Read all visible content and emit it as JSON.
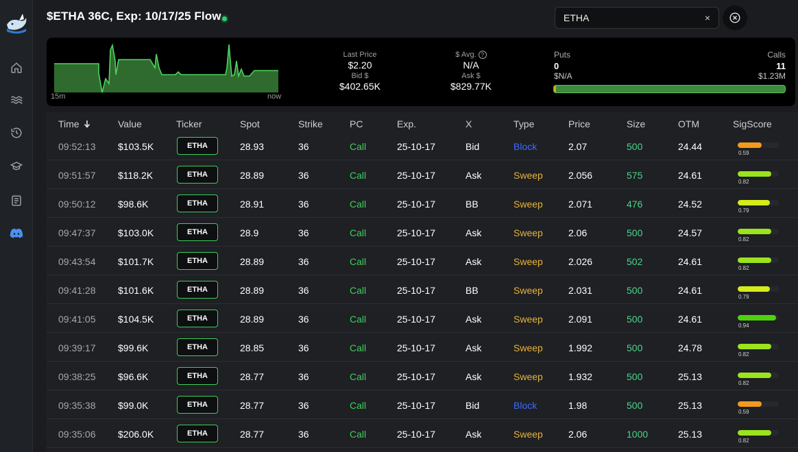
{
  "header": {
    "title": "$ETHA 36C, Exp: 10/17/25 Flow"
  },
  "search": {
    "value": "ETHA",
    "clear_glyph": "×"
  },
  "sidebar": {
    "items": [
      {
        "icon": "home-icon"
      },
      {
        "icon": "waves-icon"
      },
      {
        "icon": "history-icon"
      },
      {
        "icon": "graduation-cap-icon"
      },
      {
        "icon": "newspaper-icon"
      },
      {
        "icon": "discord-icon",
        "active": true
      }
    ]
  },
  "summary": {
    "spark_start_label": "15m",
    "spark_end_label": "now",
    "last_price_label": "Last Price",
    "last_price": "$2.20",
    "bid_label": "Bid $",
    "bid_value": "$402.65K",
    "avg_label": "$ Avg.",
    "avg_value": "N/A",
    "ask_label": "Ask $",
    "ask_value": "$829.77K",
    "puts_label": "Puts",
    "puts_count": "0",
    "puts_amount": "$N/A",
    "calls_label": "Calls",
    "calls_count": "11",
    "calls_amount": "$1.23M",
    "puts_share": 0.01
  },
  "table": {
    "columns": [
      "Time",
      "Value",
      "Ticker",
      "Spot",
      "Strike",
      "PC",
      "Exp.",
      "X",
      "Type",
      "Price",
      "Size",
      "OTM",
      "SigScore"
    ],
    "rows": [
      {
        "time": "09:52:13",
        "value": "$103.5K",
        "ticker": "ETHA",
        "spot": "28.93",
        "strike": "36",
        "pc": "Call",
        "exp": "25-10-17",
        "x": "Bid",
        "type": "Block",
        "price": "2.07",
        "size": "500",
        "otm": "24.44",
        "sig": "0.59"
      },
      {
        "time": "09:51:57",
        "value": "$118.2K",
        "ticker": "ETHA",
        "spot": "28.89",
        "strike": "36",
        "pc": "Call",
        "exp": "25-10-17",
        "x": "Ask",
        "type": "Sweep",
        "price": "2.056",
        "size": "575",
        "otm": "24.61",
        "sig": "0.82"
      },
      {
        "time": "09:50:12",
        "value": "$98.6K",
        "ticker": "ETHA",
        "spot": "28.91",
        "strike": "36",
        "pc": "Call",
        "exp": "25-10-17",
        "x": "BB",
        "type": "Sweep",
        "price": "2.071",
        "size": "476",
        "otm": "24.52",
        "sig": "0.79"
      },
      {
        "time": "09:47:37",
        "value": "$103.0K",
        "ticker": "ETHA",
        "spot": "28.9",
        "strike": "36",
        "pc": "Call",
        "exp": "25-10-17",
        "x": "Ask",
        "type": "Sweep",
        "price": "2.06",
        "size": "500",
        "otm": "24.57",
        "sig": "0.82"
      },
      {
        "time": "09:43:54",
        "value": "$101.7K",
        "ticker": "ETHA",
        "spot": "28.89",
        "strike": "36",
        "pc": "Call",
        "exp": "25-10-17",
        "x": "Ask",
        "type": "Sweep",
        "price": "2.026",
        "size": "502",
        "otm": "24.61",
        "sig": "0.82"
      },
      {
        "time": "09:41:28",
        "value": "$101.6K",
        "ticker": "ETHA",
        "spot": "28.89",
        "strike": "36",
        "pc": "Call",
        "exp": "25-10-17",
        "x": "BB",
        "type": "Sweep",
        "price": "2.031",
        "size": "500",
        "otm": "24.61",
        "sig": "0.79"
      },
      {
        "time": "09:41:05",
        "value": "$104.5K",
        "ticker": "ETHA",
        "spot": "28.89",
        "strike": "36",
        "pc": "Call",
        "exp": "25-10-17",
        "x": "Ask",
        "type": "Sweep",
        "price": "2.091",
        "size": "500",
        "otm": "24.61",
        "sig": "0.94"
      },
      {
        "time": "09:39:17",
        "value": "$99.6K",
        "ticker": "ETHA",
        "spot": "28.85",
        "strike": "36",
        "pc": "Call",
        "exp": "25-10-17",
        "x": "Ask",
        "type": "Sweep",
        "price": "1.992",
        "size": "500",
        "otm": "24.78",
        "sig": "0.82"
      },
      {
        "time": "09:38:25",
        "value": "$96.6K",
        "ticker": "ETHA",
        "spot": "28.77",
        "strike": "36",
        "pc": "Call",
        "exp": "25-10-17",
        "x": "Ask",
        "type": "Sweep",
        "price": "1.932",
        "size": "500",
        "otm": "25.13",
        "sig": "0.82"
      },
      {
        "time": "09:35:38",
        "value": "$99.0K",
        "ticker": "ETHA",
        "spot": "28.77",
        "strike": "36",
        "pc": "Call",
        "exp": "25-10-17",
        "x": "Bid",
        "type": "Block",
        "price": "1.98",
        "size": "500",
        "otm": "25.13",
        "sig": "0.59"
      },
      {
        "time": "09:35:06",
        "value": "$206.0K",
        "ticker": "ETHA",
        "spot": "28.77",
        "strike": "36",
        "pc": "Call",
        "exp": "25-10-17",
        "x": "Ask",
        "type": "Sweep",
        "price": "2.06",
        "size": "1000",
        "otm": "25.13",
        "sig": "0.82"
      }
    ]
  },
  "colors": {
    "call": "#3ecf5a",
    "sweep": "#e8b23a",
    "block": "#3d6bff",
    "size_highlight": "#4cd68a",
    "sig_059": "#f29a1d",
    "sig_079": "#d4ec1a",
    "sig_082": "#9be31c",
    "sig_094": "#4fd10f",
    "sparkline": "#4fd35f"
  }
}
